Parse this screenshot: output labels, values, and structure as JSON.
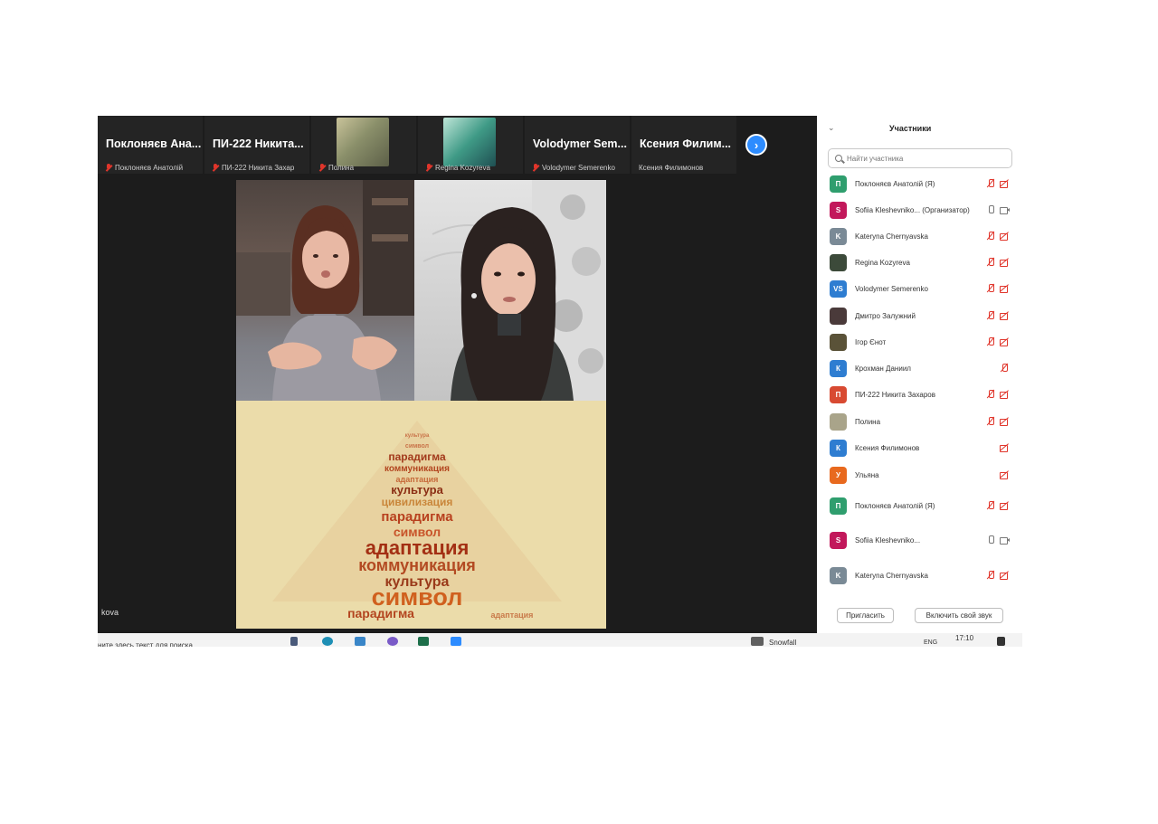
{
  "meeting": {
    "thumbnails": [
      {
        "big_name": "Поклоняєв Ана...",
        "sub_name": "Поклоняєв Анатолій",
        "muted": true
      },
      {
        "big_name": "ПИ-222 Никита...",
        "sub_name": "ПИ-222 Никита Захар",
        "muted": true
      },
      {
        "big_name": "",
        "sub_name": "Полина",
        "muted": true
      },
      {
        "big_name": "",
        "sub_name": "Regina Kozyreva",
        "muted": true
      },
      {
        "big_name": "Volodymer Sem...",
        "sub_name": "Volodymer Semerenko",
        "muted": true
      },
      {
        "big_name": "Ксения Филим...",
        "sub_name": "Ксения Филимонов",
        "muted": false
      }
    ],
    "speaker_tag": "kova",
    "wordcloud_words": [
      "культура",
      "символ",
      "парадигма",
      "коммуникация",
      "адаптация",
      "культура",
      "цивилизация",
      "парадигма",
      "символ",
      "адаптация",
      "коммуникация",
      "культура",
      "символ",
      "парадигма",
      "адаптация"
    ]
  },
  "taskbar": {
    "search_placeholder": "ните здесь текст для поиска",
    "weather": "Snowfall",
    "lang": "ENG",
    "time": "17:10"
  },
  "panel": {
    "title": "Участники",
    "search_placeholder": "Найти участника",
    "participants": [
      {
        "initial": "П",
        "color": "#2f9e6e",
        "name": "Поклоняєв Анатолій (Я)",
        "mic": "off",
        "cam": "off"
      },
      {
        "initial": "S",
        "color": "#c2185b",
        "name": "Sofiia Kleshevniko... (Организатор)",
        "mic": "on",
        "cam": "on"
      },
      {
        "initial": "K",
        "color": "#7a8a96",
        "name": "Kateryna Chernyavska",
        "mic": "off",
        "cam": "off"
      },
      {
        "initial": "",
        "color": "#3c4a3a",
        "name": "Regina Kozyreva",
        "mic": "off",
        "cam": "off"
      },
      {
        "initial": "VS",
        "color": "#2e7dd1",
        "name": "Volodymer Semerenko",
        "mic": "off",
        "cam": "off"
      },
      {
        "initial": "",
        "color": "#4a3a3a",
        "name": "Дмитро Залужний",
        "mic": "off",
        "cam": "off"
      },
      {
        "initial": "",
        "color": "#5a5238",
        "name": "Ігор Єнот",
        "mic": "off",
        "cam": "off"
      },
      {
        "initial": "К",
        "color": "#2e7dd1",
        "name": "Крохман Даниил",
        "mic": "off",
        "cam": "none"
      },
      {
        "initial": "П",
        "color": "#d84a32",
        "name": "ПИ-222 Никита Захаров",
        "mic": "off",
        "cam": "off"
      },
      {
        "initial": "",
        "color": "#a9a48a",
        "name": "Полина",
        "mic": "off",
        "cam": "off"
      },
      {
        "initial": "К",
        "color": "#2e7dd1",
        "name": "Ксения Филимонов",
        "mic": "none",
        "cam": "off"
      },
      {
        "initial": "У",
        "color": "#e8691e",
        "name": "Ульяна",
        "mic": "none",
        "cam": "off"
      },
      {
        "initial": "П",
        "color": "#2f9e6e",
        "name": "Поклоняєв Анатолій (Я)",
        "mic": "off",
        "cam": "off"
      },
      {
        "initial": "S",
        "color": "#c2185b",
        "name": "Sofiia Kleshevniko...",
        "mic": "on",
        "cam": "on"
      },
      {
        "initial": "K",
        "color": "#7a8a96",
        "name": "Kateryna Chernyavska",
        "mic": "off",
        "cam": "off"
      }
    ],
    "invite_label": "Пригласить",
    "unmute_label": "Включить свой звук"
  }
}
